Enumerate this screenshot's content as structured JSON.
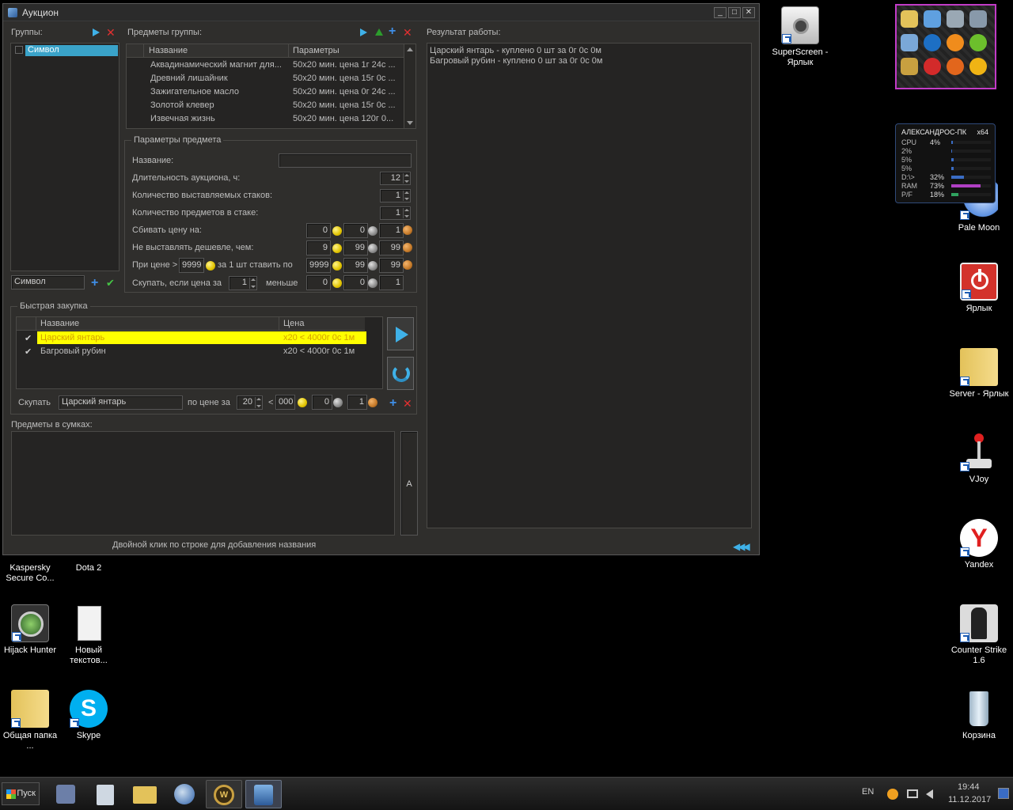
{
  "window": {
    "title": "Аукцион",
    "groups_label": "Группы:",
    "group_items": [
      "Символ"
    ],
    "group_input": "Символ",
    "items_label": "Предметы группы:",
    "items_columns": [
      "Название",
      "Параметры"
    ],
    "items_rows": [
      {
        "name": "Аквадинамический магнит для...",
        "params": "50x20 мин. цена 1г 24с ..."
      },
      {
        "name": "Древний лишайник",
        "params": "50x20 мин. цена 15г 0с ..."
      },
      {
        "name": "Зажигательное масло",
        "params": "50x20 мин. цена 0г 24с ..."
      },
      {
        "name": "Золотой клевер",
        "params": "50x20 мин. цена 15г 0с ..."
      },
      {
        "name": "Извечная жизнь",
        "params": "50x20 мин. цена 120г 0..."
      }
    ],
    "item_params": {
      "title": "Параметры предмета",
      "name_label": "Название:",
      "name_value": "",
      "duration_label": "Длительность аукциона, ч:",
      "duration_value": "12",
      "stacks_label": "Количество выставляемых стаков:",
      "stacks_value": "1",
      "per_stack_label": "Количество предметов в стаке:",
      "per_stack_value": "1",
      "undercut_label": "Сбивать цену на:",
      "undercut": [
        "0",
        "0",
        "1"
      ],
      "min_price_label": "Не выставлять дешевле, чем:",
      "min_price": [
        "9",
        "99",
        "99"
      ],
      "if_price_label": "При цене >",
      "if_price_value": "9999",
      "set_price_label": "за 1 шт ставить по",
      "set_price": [
        "9999",
        "99",
        "99"
      ],
      "buyout_label": "Скупать, если цена за",
      "buyout_qty": "1",
      "less_label": "меньше",
      "buyout_price": [
        "0",
        "0",
        "1"
      ]
    },
    "quick_buy": {
      "title": "Быстрая закупка",
      "columns": [
        "Название",
        "Цена"
      ],
      "rows": [
        {
          "check": "✔",
          "name": "Царский янтарь",
          "price": "x20 < 4000г 0с 1м",
          "selected": true
        },
        {
          "check": "✔",
          "name": "Багровый рубин",
          "price": "x20 < 4000г 0с 1м",
          "selected": false
        }
      ],
      "buy_label": "Скупать",
      "buy_item": "Царский янтарь",
      "at_price_label": "по цене за",
      "qty": "20",
      "lt": "<",
      "price": [
        "000",
        "0",
        "1"
      ]
    },
    "bags_label": "Предметы в сумках:",
    "bags_button": "A",
    "results_label": "Результат работы:",
    "results_lines": [
      "Царский янтарь - куплено 0 шт за 0г 0с 0м",
      "Багровый рубин - куплено 0 шт за 0г 0с 0м"
    ],
    "status_hint": "Двойной клик по строке для добавления названия"
  },
  "desktop": {
    "icons": [
      {
        "label": "SuperScreen - Ярлык",
        "icon": "camera-icon"
      },
      {
        "label": "Pale Moon",
        "icon": "pale-moon-icon"
      },
      {
        "label": "Ярлык",
        "icon": "power-icon"
      },
      {
        "label": "Server - Ярлык",
        "icon": "folder-icon"
      },
      {
        "label": "VJoy",
        "icon": "joystick-icon"
      },
      {
        "label": "Yandex",
        "icon": "yandex-icon"
      },
      {
        "label": "Counter Strike 1.6",
        "icon": "counter-strike-icon"
      },
      {
        "label": "Корзина",
        "icon": "recycle-bin-icon"
      },
      {
        "label": "Kaspersky Secure Co...",
        "icon": "kaspersky-icon"
      },
      {
        "label": "Dota 2",
        "icon": "dota-icon"
      },
      {
        "label": "Hijack Hunter",
        "icon": "hijack-hunter-icon"
      },
      {
        "label": "Новый текстов...",
        "icon": "text-file-icon"
      },
      {
        "label": "Общая папка ...",
        "icon": "folder-icon"
      },
      {
        "label": "Skype",
        "icon": "skype-icon"
      }
    ]
  },
  "gadget": {
    "host": "АЛЕКСАНДРОС-ПК",
    "arch": "x64",
    "rows": [
      {
        "label": "CPU",
        "value": "4%",
        "level": 0.04,
        "color": "#3a6cc4"
      },
      {
        "label": "2%",
        "value": "",
        "level": 0.02,
        "color": "#3a6cc4"
      },
      {
        "label": "5%",
        "value": "",
        "level": 0.05,
        "color": "#3a6cc4"
      },
      {
        "label": "5%",
        "value": "",
        "level": 0.05,
        "color": "#3a6cc4"
      },
      {
        "label": "D:\\>",
        "value": "32%",
        "level": 0.32,
        "color": "#3a6cc4"
      },
      {
        "label": "RAM",
        "value": "73%",
        "level": 0.73,
        "color": "#b03fc4"
      },
      {
        "label": "P/F",
        "value": "18%",
        "level": 0.18,
        "color": "#2fa25f"
      }
    ]
  },
  "taskbar": {
    "start_label": "Пуск",
    "lang": "EN",
    "time": "19:44",
    "date": "11.12.2017"
  }
}
